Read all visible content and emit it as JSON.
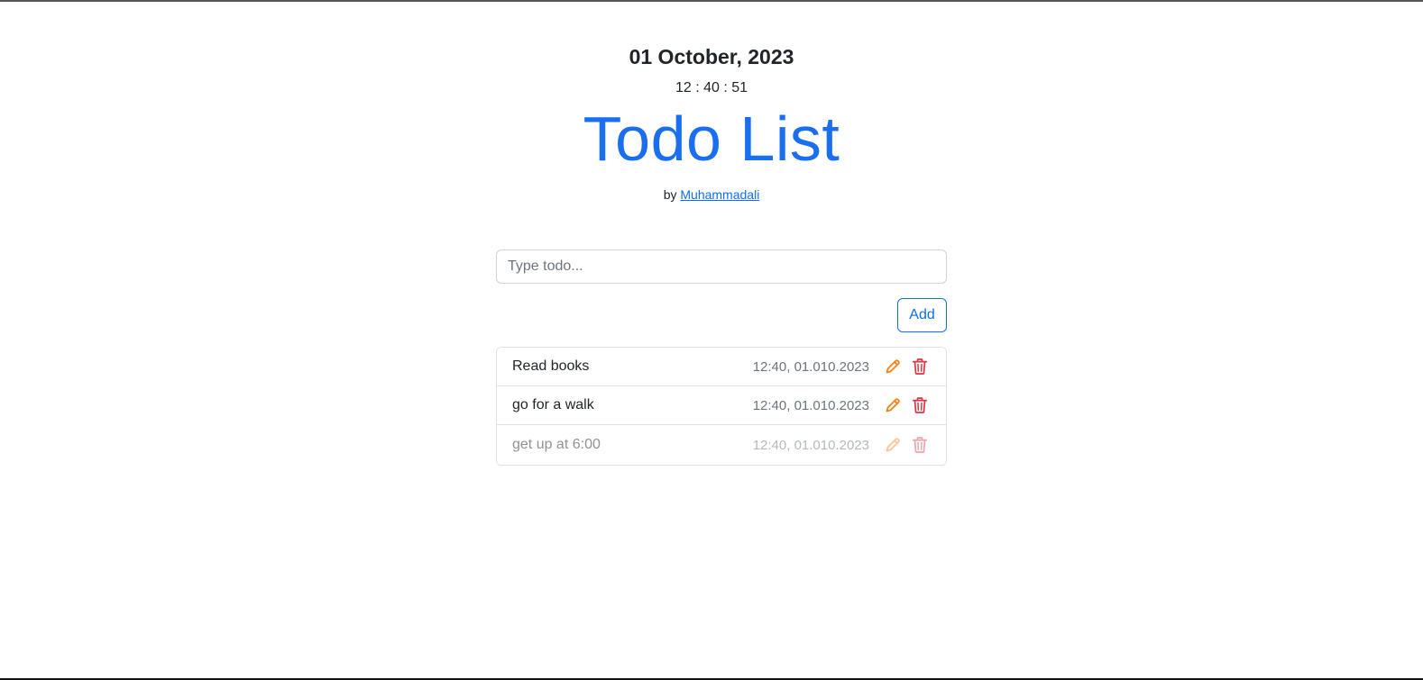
{
  "header": {
    "date": "01 October, 2023",
    "time": "12 : 40 : 51",
    "title": "Todo List",
    "byline_prefix": "by",
    "author": "Muhammadali"
  },
  "form": {
    "input_placeholder": "Type todo...",
    "input_value": "",
    "add_label": "Add"
  },
  "todos": [
    {
      "text": "Read books",
      "timestamp": "12:40, 01.010.2023",
      "completed": false
    },
    {
      "text": "go for a walk",
      "timestamp": "12:40, 01.010.2023",
      "completed": false
    },
    {
      "text": "get up at 6:00",
      "timestamp": "12:40, 01.010.2023",
      "completed": true
    }
  ],
  "icons": {
    "edit": "pencil-icon",
    "delete": "trash-icon"
  },
  "colors": {
    "accent": "#0d6efd",
    "title": "#1a6ef0",
    "edit_icon": "#fd7e14",
    "delete_icon": "#dc3545",
    "muted_text": "#6c757d"
  }
}
